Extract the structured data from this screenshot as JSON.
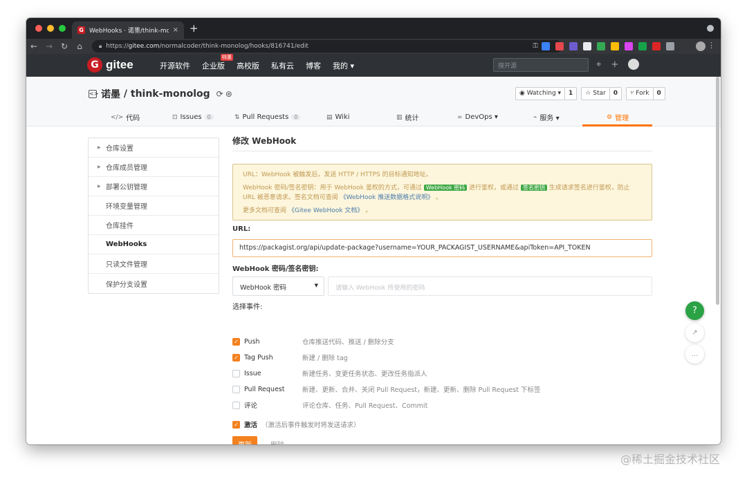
{
  "browser": {
    "tab_title": "WebHooks · 诺墨/think-monolo",
    "tab_favicon": "G",
    "url_prefix": "https://",
    "url_host": "gitee.com",
    "url_path": "/normalcoder/think-monolog/hooks/816741/edit",
    "close_symbol": "×",
    "new_tab_symbol": "+"
  },
  "gitee_header": {
    "logo_text": "gitee",
    "nav": [
      "开源软件",
      "企业版",
      "高校版",
      "私有云",
      "博客",
      "我的 ▾"
    ],
    "enterprise_badge": "特惠",
    "search_placeholder": "搜开源"
  },
  "repo": {
    "owner": "诺墨",
    "separator": " / ",
    "name": "think-monolog",
    "watching_label": "Watching ▾",
    "watching_count": "1",
    "star_label": "Star",
    "star_count": "0",
    "fork_label": "Fork",
    "fork_count": "0",
    "tabs": [
      {
        "icon": "</>",
        "label": "代码",
        "count": ""
      },
      {
        "icon": "⊡",
        "label": "Issues",
        "count": "0"
      },
      {
        "icon": "⇅",
        "label": "Pull Requests",
        "count": "0"
      },
      {
        "icon": "▤",
        "label": "Wiki",
        "count": ""
      },
      {
        "icon": "▥",
        "label": "统计",
        "count": ""
      },
      {
        "icon": "∞",
        "label": "DevOps ▾",
        "count": ""
      },
      {
        "icon": "⌁",
        "label": "服务 ▾",
        "count": ""
      },
      {
        "icon": "⚙",
        "label": "管理",
        "count": ""
      }
    ]
  },
  "sidebar": {
    "items": [
      {
        "label": "仓库设置",
        "arrow": "▶"
      },
      {
        "label": "仓库成员管理",
        "arrow": "▶"
      },
      {
        "label": "部署公钥管理",
        "arrow": "▶"
      },
      {
        "label": "环境变量管理",
        "arrow": ""
      },
      {
        "label": "仓库挂件",
        "arrow": ""
      },
      {
        "label": "WebHooks",
        "arrow": ""
      },
      {
        "label": "只读文件管理",
        "arrow": ""
      },
      {
        "label": "保护分支设置",
        "arrow": ""
      }
    ]
  },
  "main": {
    "title": "修改 WebHook",
    "notice": {
      "line1": "URL：WebHook 被触发后，发送 HTTP / HTTPS 的目标通知地址。",
      "line2_a": "WebHook 密码/签名密钥：用于 WebHook 鉴权的方式，可通过",
      "tag1": "WebHook 密码",
      "line2_b": "进行鉴权，或通过",
      "tag2": "签名密钥",
      "line2_c": "生成请求签名进行鉴权，防止 URL 被恶意请求。签名文档可查阅",
      "link1": "《WebHook 推送数据格式说明》",
      "line2_d": "。",
      "line3_a": "更多文档可查阅",
      "link2": "《Gitee WebHook 文档》",
      "line3_b": "。"
    },
    "url_label": "URL:",
    "url_value": "https://packagist.org/api/update-package?username=YOUR_PACKAGIST_USERNAME&apiToken=API_TOKEN",
    "secret_label": "WebHook 密码/签名密钥:",
    "secret_type": "WebHook 密码",
    "secret_placeholder": "请输入 WebHook 所使用的密码",
    "events_label": "选择事件:",
    "events": [
      {
        "name": "Push",
        "desc": "仓库推送代码、推送 / 删除分支",
        "checked": true
      },
      {
        "name": "Tag Push",
        "desc": "新建 / 删除 tag",
        "checked": true
      },
      {
        "name": "Issue",
        "desc": "新建任务、变更任务状态、更改任务指派人",
        "checked": false
      },
      {
        "name": "Pull Request",
        "desc": "新建、更新、合并、关闭 Pull Request，新建、更新、删除 Pull Request 下标签",
        "checked": false
      },
      {
        "name": "评论",
        "desc": "评论仓库、任务、Pull Request、Commit",
        "checked": false
      }
    ],
    "activate_label": "激活",
    "activate_desc": "（激活后事件触发时将发送请求）",
    "activate_checked": true,
    "update_button": "更新",
    "delete_button": "删除"
  },
  "float": {
    "help": "?",
    "share": "↗",
    "chat": "…"
  },
  "watermark": "@稀土掘金技术社区",
  "colors": {
    "accent": "#fe7300",
    "brand_red": "#c71d23",
    "checkbox": "#f4811f",
    "help_green": "#2ba245",
    "notice_bg": "#fdf6dc",
    "header_bg": "#2e3236"
  }
}
